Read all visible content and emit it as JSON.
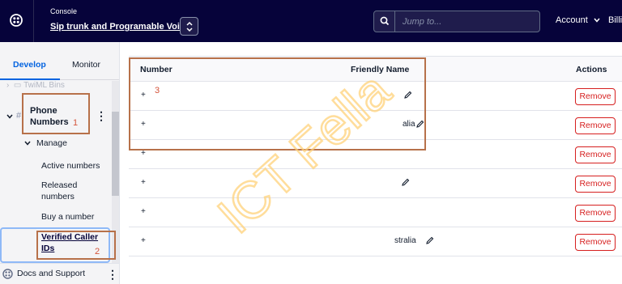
{
  "topbar": {
    "console_label": "Console",
    "project_name": "Sip trunk and Programable Voice",
    "search_placeholder": "Jump to...",
    "account_label": "Account",
    "billing_label": "Billi"
  },
  "sidebar": {
    "tabs": [
      {
        "label": "Develop",
        "active": true
      },
      {
        "label": "Monitor",
        "active": false
      }
    ],
    "faded_item": "TwiML Bins",
    "section": {
      "label": "Phone Numbers",
      "expanded": true
    },
    "group": {
      "label": "Manage",
      "expanded": true
    },
    "items": [
      {
        "label": "Active numbers",
        "selected": false
      },
      {
        "label": "Released numbers",
        "selected": false
      },
      {
        "label": "Buy a number",
        "selected": false
      },
      {
        "label": "Verified Caller IDs",
        "selected": true
      }
    ],
    "footer": {
      "label": "Docs and Support"
    }
  },
  "table": {
    "columns": {
      "number": "Number",
      "friendly_name": "Friendly Name",
      "actions": "Actions"
    },
    "rows": [
      {
        "number": "+",
        "friendly_name": "",
        "remove_label": "Remove"
      },
      {
        "number": "+",
        "friendly_name": "alia",
        "remove_label": "Remove"
      },
      {
        "number": "+",
        "friendly_name": "",
        "remove_label": "Remove"
      },
      {
        "number": "+",
        "friendly_name": "",
        "remove_label": "Remove"
      },
      {
        "number": "+",
        "friendly_name": "",
        "remove_label": "Remove"
      },
      {
        "number": "+",
        "friendly_name": "stralia",
        "remove_label": "Remove"
      }
    ]
  },
  "annotations": {
    "labels": [
      "1",
      "2",
      "3"
    ],
    "color": "#b7714a"
  },
  "watermark": {
    "text": "ICT Fella",
    "color": "#ffd27a"
  },
  "colors": {
    "topbar_bg": "#06033a",
    "accent": "#0263e0",
    "danger": "#d61f1f"
  }
}
